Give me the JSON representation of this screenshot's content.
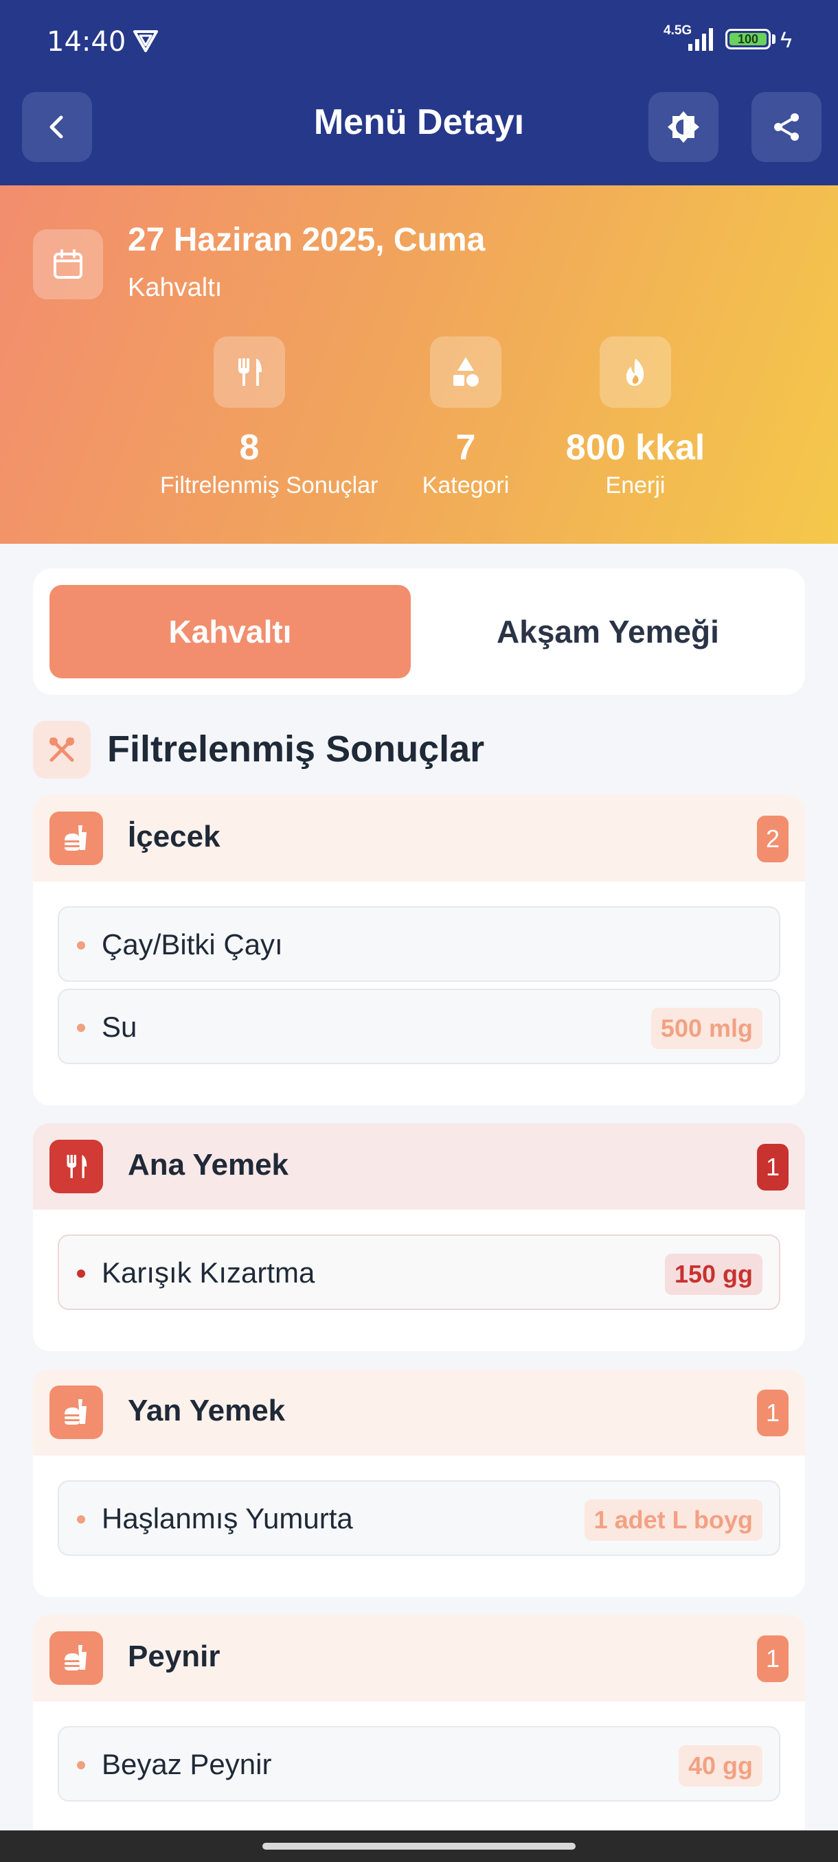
{
  "status_bar": {
    "time": "14:40",
    "network": "4.5G",
    "battery": "100"
  },
  "app_bar": {
    "title": "Menü Detayı",
    "back_icon": "arrow-left-icon",
    "theme_icon": "brightness-icon",
    "share_icon": "share-icon"
  },
  "hero": {
    "date": "27 Haziran 2025, Cuma",
    "meal": "Kahvaltı",
    "stats": [
      {
        "icon": "utensils-icon",
        "value": "8",
        "label": "Filtrelenmiş Sonuçlar"
      },
      {
        "icon": "shapes-icon",
        "value": "7",
        "label": "Kategori"
      },
      {
        "icon": "flame-icon",
        "value": "800 kkal",
        "label": "Enerji"
      }
    ]
  },
  "tabs": [
    {
      "label": "Kahvaltı",
      "active": true
    },
    {
      "label": "Akşam Yemeği",
      "active": false
    }
  ],
  "section": {
    "title": "Filtrelenmiş Sonuçlar",
    "icon": "crossed-utensils-icon"
  },
  "categories": [
    {
      "name": "İçecek",
      "count": "2",
      "icon": "food-icon",
      "color": "#f28e6e",
      "items": [
        {
          "name": "Çay/Bitki Çayı",
          "qty": ""
        },
        {
          "name": "Su",
          "qty": "500 mlg"
        }
      ]
    },
    {
      "name": "Ana Yemek",
      "count": "1",
      "icon": "utensils-icon",
      "color": "#c8322f",
      "items": [
        {
          "name": "Karışık Kızartma",
          "qty": "150 gg"
        }
      ]
    },
    {
      "name": "Yan Yemek",
      "count": "1",
      "icon": "food-icon",
      "color": "#f28e6e",
      "items": [
        {
          "name": "Haşlanmış Yumurta",
          "qty": "1 adet L boyg"
        }
      ]
    },
    {
      "name": "Peynir",
      "count": "1",
      "icon": "food-icon",
      "color": "#f28e6e",
      "items": [
        {
          "name": "Beyaz Peynir",
          "qty": "40 gg"
        }
      ]
    }
  ]
}
